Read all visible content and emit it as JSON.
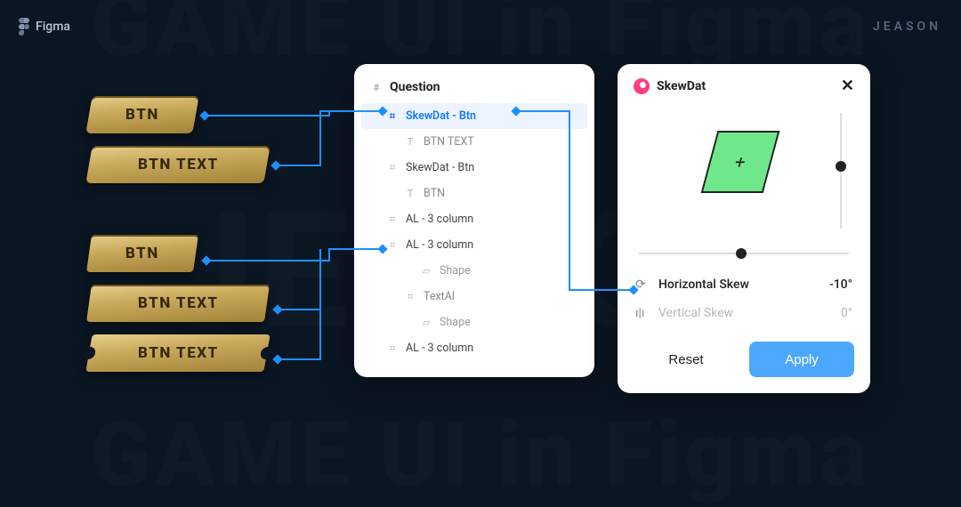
{
  "app": {
    "name": "Figma"
  },
  "branding": {
    "author": "JEASON",
    "bg_line": "GAME UI in Figma",
    "bg_mid": "JEASON"
  },
  "gold_buttons": {
    "b1": "BTN",
    "b2": "BTN TEXT",
    "b3": "BTN",
    "b4": "BTN TEXT",
    "b5": "BTN TEXT"
  },
  "layers": {
    "title": "Question",
    "rows": [
      {
        "icon": "⌗",
        "label": "SkewDat - Btn",
        "depth": 1,
        "selected": true
      },
      {
        "icon": "T",
        "label": "BTN TEXT",
        "depth": 2
      },
      {
        "icon": "⌗",
        "label": "SkewDat - Btn",
        "depth": 1
      },
      {
        "icon": "T",
        "label": "BTN",
        "depth": 2
      },
      {
        "icon": "⌗",
        "label": "AL - 3 column",
        "depth": 1
      },
      {
        "icon": "⌗",
        "label": "AL - 3 column",
        "depth": 1
      },
      {
        "icon": "▱",
        "label": "Shape",
        "depth": 3
      },
      {
        "icon": "⌗",
        "label": "TextAl",
        "depth": 2
      },
      {
        "icon": "▱",
        "label": "Shape",
        "depth": 3
      },
      {
        "icon": "⌗",
        "label": "AL - 3 column",
        "depth": 1
      }
    ]
  },
  "plugin": {
    "name": "SkewDat",
    "preview_plus": "+",
    "h_label": "Horizontal Skew",
    "h_value": "-10°",
    "v_label": "Vertical Skew",
    "v_value": "0°",
    "reset": "Reset",
    "apply": "Apply"
  }
}
